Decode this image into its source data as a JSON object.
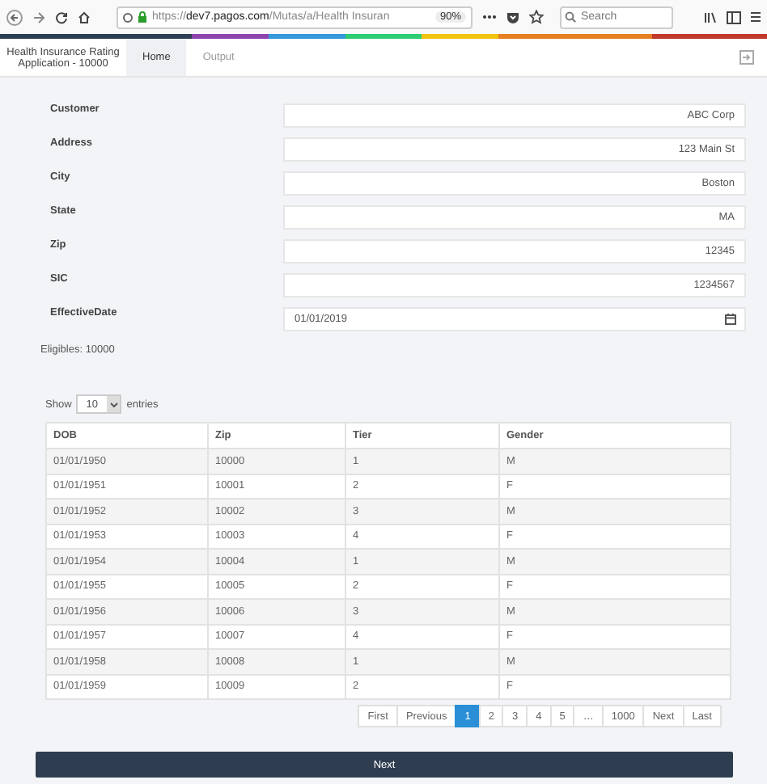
{
  "browser": {
    "url": "https://**dev7.pagos.com**/Mutas/a/Health Insuran",
    "zoom": "90%",
    "search_placeholder": "Search"
  },
  "app": {
    "title": "Health Insurance Rating Application - 10000",
    "tabs": [
      {
        "label": "Home",
        "selected": true
      },
      {
        "label": "Output",
        "selected": false
      }
    ]
  },
  "form": {
    "fields": [
      {
        "label": "Customer",
        "value": "ABC Corp",
        "kind": "text"
      },
      {
        "label": "Address",
        "value": "123 Main St",
        "kind": "text"
      },
      {
        "label": "City",
        "value": "Boston",
        "kind": "text"
      },
      {
        "label": "State",
        "value": "MA",
        "kind": "text"
      },
      {
        "label": "Zip",
        "value": "12345",
        "kind": "text"
      },
      {
        "label": "SIC",
        "value": "1234567",
        "kind": "text"
      },
      {
        "label": "EffectiveDate",
        "value": "01/01/2019",
        "kind": "date"
      }
    ]
  },
  "eligibles": "Eligibles: 10000",
  "length": {
    "show": "Show",
    "value": "10",
    "entries": "entries"
  },
  "table": {
    "columns": [
      "DOB",
      "Zip",
      "Tier",
      "Gender"
    ],
    "rows": [
      [
        "01/01/1950",
        "10000",
        "1",
        "M"
      ],
      [
        "01/01/1951",
        "10001",
        "2",
        "F"
      ],
      [
        "01/01/1952",
        "10002",
        "3",
        "M"
      ],
      [
        "01/01/1953",
        "10003",
        "4",
        "F"
      ],
      [
        "01/01/1954",
        "10004",
        "1",
        "M"
      ],
      [
        "01/01/1955",
        "10005",
        "2",
        "F"
      ],
      [
        "01/01/1956",
        "10006",
        "3",
        "M"
      ],
      [
        "01/01/1957",
        "10007",
        "4",
        "F"
      ],
      [
        "01/01/1958",
        "10008",
        "1",
        "M"
      ],
      [
        "01/01/1959",
        "10009",
        "2",
        "F"
      ]
    ]
  },
  "pagination": [
    {
      "label": "First",
      "selected": false
    },
    {
      "label": "Previous",
      "selected": false
    },
    {
      "label": "1",
      "selected": true
    },
    {
      "label": "2",
      "selected": false
    },
    {
      "label": "3",
      "selected": false
    },
    {
      "label": "4",
      "selected": false
    },
    {
      "label": "5",
      "selected": false
    },
    {
      "label": "…",
      "selected": false
    },
    {
      "label": "1000",
      "selected": false
    },
    {
      "label": "Next",
      "selected": false
    },
    {
      "label": "Last",
      "selected": false
    }
  ],
  "next_button": "Next"
}
